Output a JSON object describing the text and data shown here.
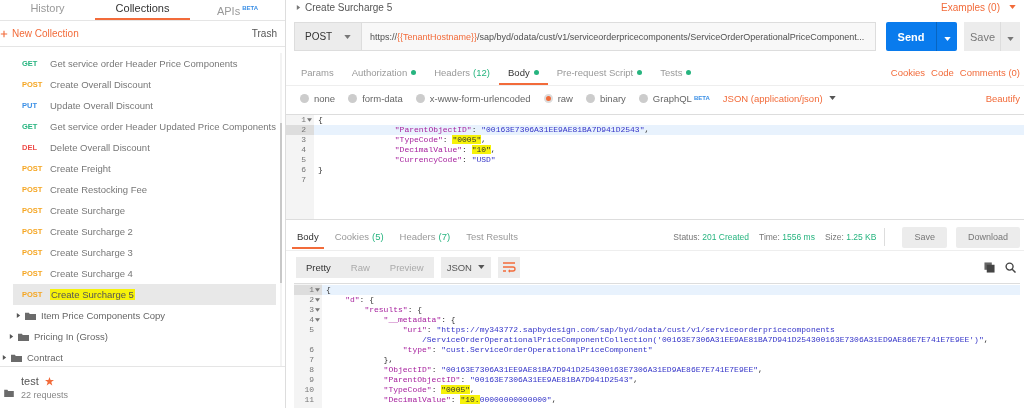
{
  "sidebar": {
    "tabs": [
      {
        "label": "History",
        "selected": false
      },
      {
        "label": "Collections",
        "selected": true
      },
      {
        "label": "APIs",
        "badge": "BETA",
        "selected": false
      }
    ],
    "new_collection": "New Collection",
    "trash": "Trash",
    "tree": [
      {
        "kind": "group",
        "children": [
          {
            "kind": "group",
            "children": [
              {
                "kind": "group",
                "children": [
                  {
                    "kind": "request",
                    "method": "GET",
                    "label": "Get service order Header Price Components",
                    "selected": false,
                    "highlighted": false
                  },
                  {
                    "kind": "request",
                    "method": "POST",
                    "label": "Create Overall Discount",
                    "selected": false,
                    "highlighted": false
                  },
                  {
                    "kind": "request",
                    "method": "PUT",
                    "label": "Update Overall Discount",
                    "selected": false,
                    "highlighted": false
                  },
                  {
                    "kind": "request",
                    "method": "GET",
                    "label": "Get service order Header Updated Price Components",
                    "selected": false,
                    "highlighted": false
                  },
                  {
                    "kind": "request",
                    "method": "DEL",
                    "label": "Delete Overall Discount",
                    "selected": false,
                    "highlighted": false
                  },
                  {
                    "kind": "request",
                    "method": "POST",
                    "label": "Create Freight",
                    "selected": false,
                    "highlighted": false
                  },
                  {
                    "kind": "request",
                    "method": "POST",
                    "label": "Create Restocking Fee",
                    "selected": false,
                    "highlighted": false
                  },
                  {
                    "kind": "request",
                    "method": "POST",
                    "label": "Create Surcharge",
                    "selected": false,
                    "highlighted": false
                  },
                  {
                    "kind": "request",
                    "method": "POST",
                    "label": "Create Surcharge 2",
                    "selected": false,
                    "highlighted": false
                  },
                  {
                    "kind": "request",
                    "method": "POST",
                    "label": "Create Surcharge 3",
                    "selected": false,
                    "highlighted": false
                  },
                  {
                    "kind": "request",
                    "method": "POST",
                    "label": "Create Surcharge 4",
                    "selected": false,
                    "highlighted": false
                  },
                  {
                    "kind": "request",
                    "method": "POST",
                    "label": "Create Surcharge 5",
                    "selected": true,
                    "highlighted": true
                  }
                ]
              },
              {
                "kind": "folder",
                "label": "Item Price Components Copy",
                "expanded": false
              }
            ]
          },
          {
            "kind": "folder",
            "label": "Pricing In (Gross)",
            "expanded": false
          }
        ]
      },
      {
        "kind": "folder",
        "label": "Contract",
        "expanded": false
      }
    ],
    "collection": {
      "name": "test",
      "starred": true,
      "count": "22 requests"
    }
  },
  "request": {
    "title": "Create Surcharge 5",
    "examples": "Examples (0)",
    "method": "POST",
    "url": [
      {
        "kind": "plain",
        "text": "https://"
      },
      {
        "kind": "variable",
        "text": "{{TenantHostname}}"
      },
      {
        "kind": "plain",
        "text": "/sap/byd/odata/cust/v1/serviceorderpricecomponents/ServiceOrderOperationalPriceComponent..."
      }
    ],
    "send": "Send",
    "save": "Save",
    "tabs": [
      {
        "label": "Params",
        "dot": false,
        "selected": false
      },
      {
        "label": "Authorization",
        "dot": true,
        "selected": false
      },
      {
        "label": "Headers",
        "count": "(12)",
        "dot": false,
        "selected": false
      },
      {
        "label": "Body",
        "dot": true,
        "selected": true
      },
      {
        "label": "Pre-request Script",
        "dot": true,
        "selected": false
      },
      {
        "label": "Tests",
        "dot": true,
        "selected": false
      }
    ],
    "links": [
      "Cookies",
      "Code",
      "Comments (0)"
    ],
    "body_types": [
      {
        "label": "none",
        "selected": false
      },
      {
        "label": "form-data",
        "selected": false
      },
      {
        "label": "x-www-form-urlencoded",
        "selected": false
      },
      {
        "label": "raw",
        "selected": true
      },
      {
        "label": "binary",
        "selected": false
      },
      {
        "label": "GraphQL",
        "badge": "BETA",
        "selected": false
      }
    ],
    "content_type": "JSON (application/json)",
    "beautify": "Beautify",
    "code": [
      {
        "number": "1",
        "fold": true,
        "active": false,
        "tokens": [
          {
            "kind": "punct",
            "text": "{"
          }
        ]
      },
      {
        "number": "2",
        "fold": false,
        "active": true,
        "tokens": [
          {
            "kind": "key",
            "text": "                \"ParentObjectID\""
          },
          {
            "kind": "punct",
            "text": ": "
          },
          {
            "kind": "string",
            "text": "\"00163E7306A31EE9AE81BA7D941D2543\""
          },
          {
            "kind": "punct",
            "text": ","
          }
        ]
      },
      {
        "number": "3",
        "fold": false,
        "active": false,
        "tokens": [
          {
            "kind": "key",
            "text": "                \"TypeCode\""
          },
          {
            "kind": "punct",
            "text": ": "
          },
          {
            "kind": "marked",
            "text": "\"0005\""
          },
          {
            "kind": "punct",
            "text": ","
          }
        ]
      },
      {
        "number": "4",
        "fold": false,
        "active": false,
        "tokens": [
          {
            "kind": "key",
            "text": "                \"DecimalValue\""
          },
          {
            "kind": "punct",
            "text": ": "
          },
          {
            "kind": "marked",
            "text": "\"10\""
          },
          {
            "kind": "punct",
            "text": ","
          }
        ]
      },
      {
        "number": "5",
        "fold": false,
        "active": false,
        "tokens": [
          {
            "kind": "key",
            "text": "                \"CurrencyCode\""
          },
          {
            "kind": "punct",
            "text": ": "
          },
          {
            "kind": "string",
            "text": "\"USD\""
          }
        ]
      },
      {
        "number": "6",
        "fold": false,
        "active": false,
        "tokens": [
          {
            "kind": "punct",
            "text": "}"
          }
        ]
      },
      {
        "number": "7",
        "fold": false,
        "active": false
      }
    ]
  },
  "response": {
    "tabs": [
      {
        "label": "Body",
        "selected": true
      },
      {
        "label": "Cookies",
        "count": "(5)",
        "selected": false
      },
      {
        "label": "Headers",
        "count": "(7)",
        "selected": false
      },
      {
        "label": "Test Results",
        "selected": false
      }
    ],
    "status": [
      {
        "label": "Status:",
        "value": "201 Created"
      },
      {
        "label": "Time:",
        "value": "1556 ms"
      },
      {
        "label": "Size:",
        "value": "1.25 KB"
      }
    ],
    "buttons": [
      "Save",
      "Download"
    ],
    "views": [
      {
        "label": "Pretty",
        "selected": true
      },
      {
        "label": "Raw",
        "selected": false
      },
      {
        "label": "Preview",
        "selected": false
      }
    ],
    "format": "JSON",
    "code": [
      {
        "number": "1",
        "fold": true,
        "active": true,
        "tokens": [
          {
            "kind": "punct",
            "text": "{"
          }
        ]
      },
      {
        "number": "2",
        "fold": true,
        "active": false,
        "tokens": [
          {
            "kind": "key",
            "text": "    \"d\""
          },
          {
            "kind": "punct",
            "text": ": {"
          }
        ]
      },
      {
        "number": "3",
        "fold": true,
        "active": false,
        "tokens": [
          {
            "kind": "key",
            "text": "        \"results\""
          },
          {
            "kind": "punct",
            "text": ": {"
          }
        ]
      },
      {
        "number": "4",
        "fold": true,
        "active": false,
        "tokens": [
          {
            "kind": "key",
            "text": "            \"__metadata\""
          },
          {
            "kind": "punct",
            "text": ": {"
          }
        ]
      },
      {
        "number": "5",
        "fold": false,
        "active": false,
        "tokens": [
          {
            "kind": "key",
            "text": "                \"uri\""
          },
          {
            "kind": "punct",
            "text": ": "
          },
          {
            "kind": "string",
            "text": "\"https://my343772.sapbydesign.com/sap/byd/odata/cust/v1/serviceorderpricecomponents"
          }
        ]
      },
      {
        "fold": false,
        "active": false,
        "tokens": [
          {
            "kind": "string",
            "text": "                    /ServiceOrderOperationalPriceComponentCollection('00163E7306A31EE9AE81BA7D941D254300163E7306A31ED9AE86E7E741E7E9EE')\""
          },
          {
            "kind": "punct",
            "text": ","
          }
        ]
      },
      {
        "number": "6",
        "fold": false,
        "active": false,
        "tokens": [
          {
            "kind": "key",
            "text": "                \"type\""
          },
          {
            "kind": "punct",
            "text": ": "
          },
          {
            "kind": "string",
            "text": "\"cust.ServiceOrderOperationalPriceComponent\""
          }
        ]
      },
      {
        "number": "7",
        "fold": false,
        "active": false,
        "tokens": [
          {
            "kind": "punct",
            "text": "            },"
          }
        ]
      },
      {
        "number": "8",
        "fold": false,
        "active": false,
        "tokens": [
          {
            "kind": "key",
            "text": "            \"ObjectID\""
          },
          {
            "kind": "punct",
            "text": ": "
          },
          {
            "kind": "string",
            "text": "\"00163E7306A31EE9AE81BA7D941D254300163E7306A31ED9AE86E7E741E7E9EE\""
          },
          {
            "kind": "punct",
            "text": ","
          }
        ]
      },
      {
        "number": "9",
        "fold": false,
        "active": false,
        "tokens": [
          {
            "kind": "key",
            "text": "            \"ParentObjectID\""
          },
          {
            "kind": "punct",
            "text": ": "
          },
          {
            "kind": "string",
            "text": "\"00163E7306A31EE9AE81BA7D941D2543\""
          },
          {
            "kind": "punct",
            "text": ","
          }
        ]
      },
      {
        "number": "10",
        "fold": false,
        "active": false,
        "tokens": [
          {
            "kind": "key",
            "text": "            \"TypeCode\""
          },
          {
            "kind": "punct",
            "text": ": "
          },
          {
            "kind": "marked",
            "text": "\"0005\""
          },
          {
            "kind": "punct",
            "text": ","
          }
        ]
      },
      {
        "number": "11",
        "fold": false,
        "active": false,
        "tokens": [
          {
            "kind": "key",
            "text": "            \"DecimalValue\""
          },
          {
            "kind": "punct",
            "text": ": "
          },
          {
            "kind": "marked",
            "text": "\"10."
          },
          {
            "kind": "string",
            "text": "00000000000000\""
          },
          {
            "kind": "punct",
            "text": ","
          }
        ]
      }
    ]
  }
}
